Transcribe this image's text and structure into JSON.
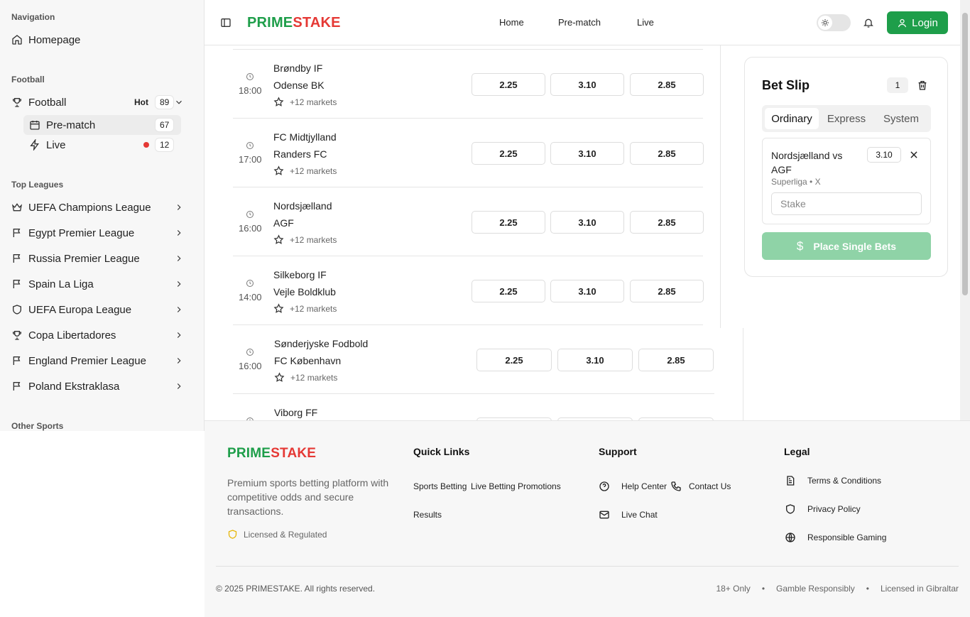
{
  "sidebar": {
    "nav_title": "Navigation",
    "homepage": "Homepage",
    "football_section": "Football",
    "football": {
      "label": "Football",
      "hot": "Hot",
      "count": "89"
    },
    "prematch": {
      "label": "Pre-match",
      "count": "67"
    },
    "live": {
      "label": "Live",
      "count": "12"
    },
    "leagues_title": "Top Leagues",
    "leagues": [
      "UEFA Champions League",
      "Egypt Premier League",
      "Russia Premier League",
      "Spain La Liga",
      "UEFA Europa League",
      "Copa Libertadores",
      "England Premier League",
      "Poland Ekstraklasa"
    ],
    "other_title": "Other Sports"
  },
  "header": {
    "logo_a": "PRIME",
    "logo_b": "STAKE",
    "nav": [
      "Home",
      "Pre-match",
      "Live"
    ],
    "login": "Login"
  },
  "matches": [
    {
      "time": "18:00",
      "home": "Brøndby IF",
      "away": "Odense BK",
      "markets": "+12 markets",
      "odds": [
        "2.25",
        "3.10",
        "2.85"
      ]
    },
    {
      "time": "17:00",
      "home": "FC Midtjylland",
      "away": "Randers FC",
      "markets": "+12 markets",
      "odds": [
        "2.25",
        "3.10",
        "2.85"
      ]
    },
    {
      "time": "16:00",
      "home": "Nordsjælland",
      "away": "AGF",
      "markets": "+12 markets",
      "odds": [
        "2.25",
        "3.10",
        "2.85"
      ]
    },
    {
      "time": "14:00",
      "home": "Silkeborg IF",
      "away": "Vejle Boldklub",
      "markets": "+12 markets",
      "odds": [
        "2.25",
        "3.10",
        "2.85"
      ]
    },
    {
      "time": "16:00",
      "home": "Sønderjyske Fodbold",
      "away": "FC København",
      "markets": "+12 markets",
      "odds": [
        "2.25",
        "3.10",
        "2.85"
      ]
    },
    {
      "time": "",
      "home": "Viborg FF",
      "away": "",
      "markets": "",
      "odds": [
        "",
        "",
        ""
      ]
    }
  ],
  "betslip": {
    "title": "Bet Slip",
    "count": "1",
    "tabs": [
      "Ordinary",
      "Express",
      "System"
    ],
    "selection": {
      "name": "Nordsjælland vs AGF",
      "league": "Superliga • X",
      "odd": "3.10"
    },
    "stake_placeholder": "Stake",
    "place": "Place Single Bets"
  },
  "footer": {
    "logo_a": "PRIME",
    "logo_b": "STAKE",
    "desc": "Premium sports betting platform with competitive odds and secure transactions.",
    "licensed": "Licensed & Regulated",
    "quick_title": "Quick Links",
    "quick": [
      "Sports Betting",
      "Live Betting",
      "Promotions",
      "Results"
    ],
    "support_title": "Support",
    "support": [
      "Help Center",
      "Contact Us",
      "Live Chat"
    ],
    "legal_title": "Legal",
    "legal": [
      "Terms & Conditions",
      "Privacy Policy",
      "Responsible Gaming"
    ],
    "copyright": "© 2025 PRIMESTAKE. All rights reserved.",
    "bottom": [
      "18+ Only",
      "•",
      "Gamble Responsibly",
      "•",
      "Licensed in Gibraltar"
    ]
  }
}
